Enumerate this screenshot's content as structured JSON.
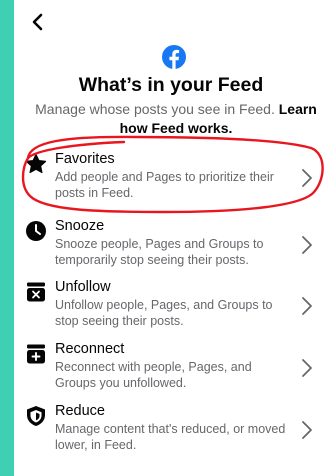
{
  "header": {
    "title": "What’s in your Feed",
    "subtitle": "Manage whose posts you see in Feed.",
    "learn_link": "Learn how Feed works."
  },
  "items": [
    {
      "label": "Favorites",
      "desc": "Add people and Pages to prioritize their posts in Feed.",
      "icon": "star-icon"
    },
    {
      "label": "Snooze",
      "desc": "Snooze people, Pages and Groups to temporarily stop seeing their posts.",
      "icon": "clock-icon"
    },
    {
      "label": "Unfollow",
      "desc": "Unfollow people, Pages, and Groups to stop seeing their posts.",
      "icon": "unfollow-icon"
    },
    {
      "label": "Reconnect",
      "desc": "Reconnect with people, Pages, and Groups you unfollowed.",
      "icon": "reconnect-icon"
    },
    {
      "label": "Reduce",
      "desc": "Manage content that's reduced, or moved lower, in Feed.",
      "icon": "shield-icon"
    }
  ],
  "colors": {
    "background": "#3fd0b4",
    "facebook_blue": "#1877f2",
    "annotation_red": "#e8171f",
    "text_primary": "#050505",
    "text_secondary": "#65676b"
  }
}
